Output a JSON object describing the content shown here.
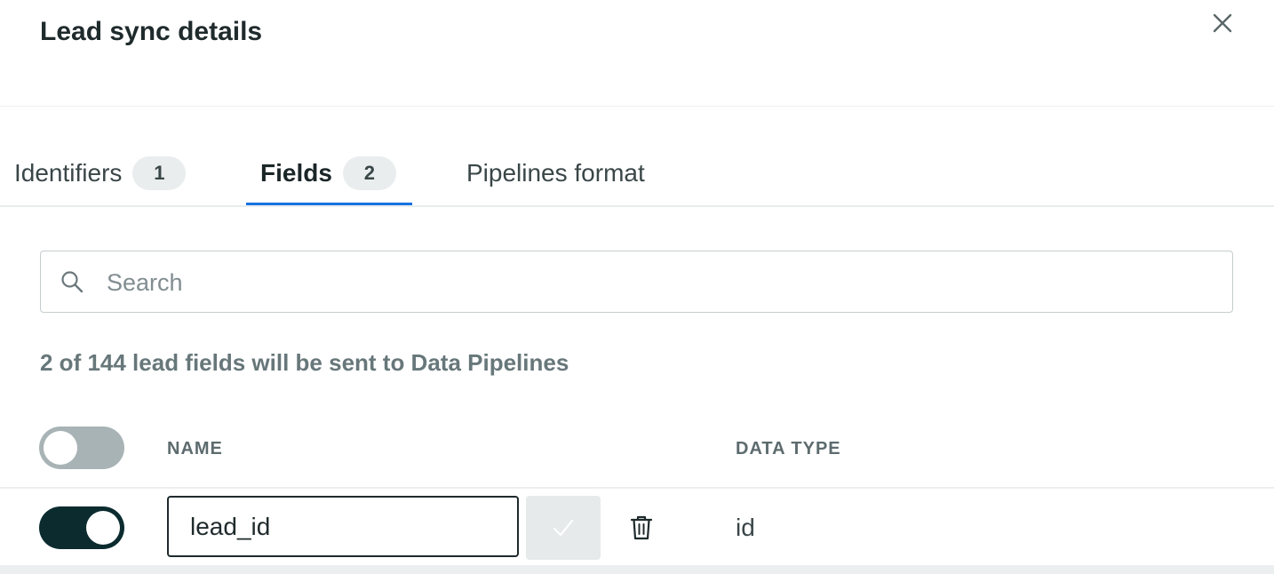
{
  "dialog": {
    "title": "Lead sync details"
  },
  "tabs": [
    {
      "label": "Identifiers",
      "count": "1",
      "active": false
    },
    {
      "label": "Fields",
      "count": "2",
      "active": true
    },
    {
      "label": "Pipelines format",
      "active": false
    }
  ],
  "search": {
    "placeholder": "Search",
    "value": ""
  },
  "summary": "2 of 144 lead fields will be sent to Data Pipelines",
  "table": {
    "select_all_toggle": "off",
    "columns": [
      "NAME",
      "DATA TYPE"
    ],
    "rows": [
      {
        "enabled": "on",
        "name": "lead_id",
        "data_type": "id"
      }
    ]
  },
  "icons": {
    "close": "close-icon",
    "search": "search-icon",
    "confirm": "check-icon",
    "delete": "trash-icon"
  },
  "colors": {
    "accent": "#1672e0",
    "toggle_on": "#0b2b2f",
    "toggle_off": "#a8b3b5"
  }
}
